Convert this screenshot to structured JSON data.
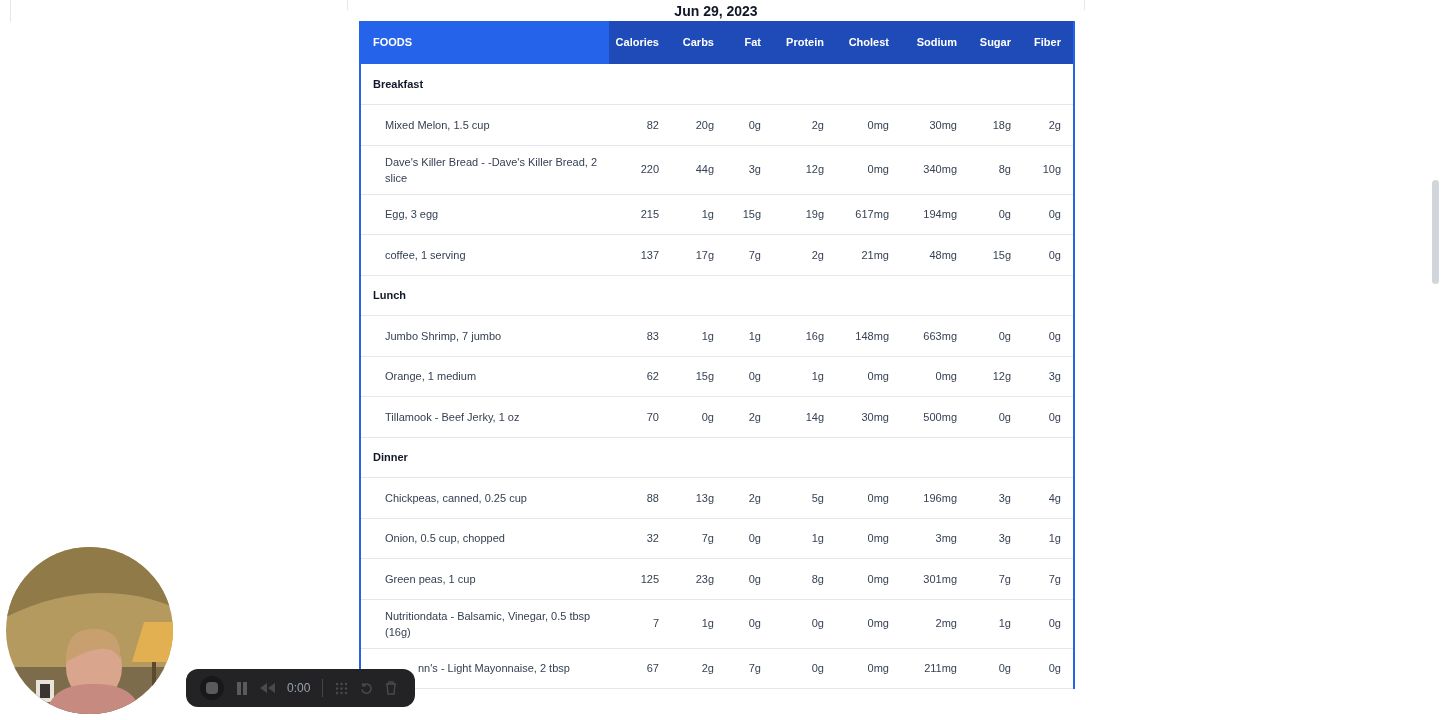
{
  "date": "Jun 29, 2023",
  "table": {
    "columns": [
      "FOODS",
      "Calories",
      "Carbs",
      "Fat",
      "Protein",
      "Cholest",
      "Sodium",
      "Sugar",
      "Fiber"
    ],
    "rows": [
      {
        "kind": "meal",
        "name": "Breakfast"
      },
      {
        "kind": "food",
        "name": "Mixed Melon, 1.5 cup",
        "values": [
          "82",
          "20g",
          "0g",
          "2g",
          "0mg",
          "30mg",
          "18g",
          "2g"
        ]
      },
      {
        "kind": "food",
        "name": "Dave's Killer Bread - -Dave's Killer Bread, 2 slice",
        "values": [
          "220",
          "44g",
          "3g",
          "12g",
          "0mg",
          "340mg",
          "8g",
          "10g"
        ]
      },
      {
        "kind": "food",
        "name": "Egg, 3 egg",
        "values": [
          "215",
          "1g",
          "15g",
          "19g",
          "617mg",
          "194mg",
          "0g",
          "0g"
        ]
      },
      {
        "kind": "food",
        "name": "coffee, 1 serving",
        "values": [
          "137",
          "17g",
          "7g",
          "2g",
          "21mg",
          "48mg",
          "15g",
          "0g"
        ]
      },
      {
        "kind": "meal",
        "name": "Lunch"
      },
      {
        "kind": "food",
        "name": "Jumbo Shrimp, 7 jumbo",
        "values": [
          "83",
          "1g",
          "1g",
          "16g",
          "148mg",
          "663mg",
          "0g",
          "0g"
        ]
      },
      {
        "kind": "food",
        "name": "Orange, 1 medium",
        "values": [
          "62",
          "15g",
          "0g",
          "1g",
          "0mg",
          "0mg",
          "12g",
          "3g"
        ]
      },
      {
        "kind": "food",
        "name": "Tillamook - Beef Jerky, 1 oz",
        "values": [
          "70",
          "0g",
          "2g",
          "14g",
          "30mg",
          "500mg",
          "0g",
          "0g"
        ]
      },
      {
        "kind": "meal",
        "name": "Dinner"
      },
      {
        "kind": "food",
        "name": "Chickpeas, canned, 0.25 cup",
        "values": [
          "88",
          "13g",
          "2g",
          "5g",
          "0mg",
          "196mg",
          "3g",
          "4g"
        ]
      },
      {
        "kind": "food",
        "name": "Onion, 0.5 cup, chopped",
        "values": [
          "32",
          "7g",
          "0g",
          "1g",
          "0mg",
          "3mg",
          "3g",
          "1g"
        ]
      },
      {
        "kind": "food",
        "name": "Green peas, 1 cup",
        "values": [
          "125",
          "23g",
          "0g",
          "8g",
          "0mg",
          "301mg",
          "7g",
          "7g"
        ]
      },
      {
        "kind": "food",
        "name": "Nutritiondata - Balsamic, Vinegar, 0.5 tbsp (16g)",
        "values": [
          "7",
          "1g",
          "0g",
          "0g",
          "0mg",
          "2mg",
          "1g",
          "0g"
        ]
      },
      {
        "kind": "covered",
        "name": "nn's - Light Mayonnaise, 2 tbsp",
        "values": [
          "67",
          "2g",
          "7g",
          "0g",
          "0mg",
          "211mg",
          "0g",
          "0g"
        ]
      }
    ]
  },
  "recorder": {
    "time": "0:00"
  }
}
